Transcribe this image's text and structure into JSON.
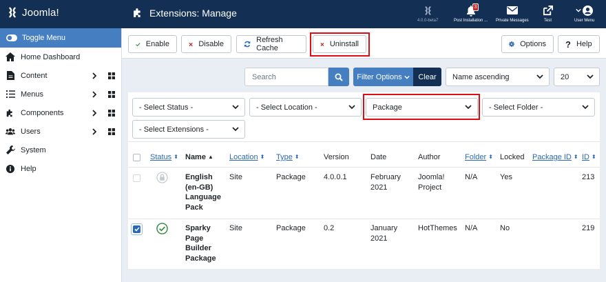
{
  "app": {
    "brand": "Joomla!",
    "page_title": "Extensions: Manage"
  },
  "header": {
    "version": "4.0.0-beta7",
    "post_install": {
      "label": "Post Installation ...",
      "count": "3"
    },
    "private_messages": "Private Messages",
    "site": "Test",
    "user_menu": "User Menu"
  },
  "sidebar": {
    "toggle": "Toggle Menu",
    "items": [
      {
        "label": "Home Dashboard"
      },
      {
        "label": "Content"
      },
      {
        "label": "Menus"
      },
      {
        "label": "Components"
      },
      {
        "label": "Users"
      },
      {
        "label": "System"
      },
      {
        "label": "Help"
      }
    ]
  },
  "toolbar": {
    "enable": "Enable",
    "disable": "Disable",
    "refresh": "Refresh Cache",
    "uninstall": "Uninstall",
    "options": "Options",
    "help": "Help"
  },
  "search": {
    "placeholder": "Search",
    "filter_options": "Filter Options",
    "clear": "Clear",
    "ordering": "Name ascending",
    "limit": "20"
  },
  "filters": {
    "status": "- Select Status -",
    "location": "- Select Location -",
    "type": "Package",
    "folder": "- Select Folder -",
    "extensions": "- Select Extensions -"
  },
  "table": {
    "headers": {
      "status": "Status",
      "name": "Name",
      "location": "Location",
      "type": "Type",
      "version": "Version",
      "date": "Date",
      "author": "Author",
      "folder": "Folder",
      "locked": "Locked",
      "package_id": "Package ID",
      "id": "ID"
    },
    "rows": [
      {
        "checked": false,
        "status": "locked",
        "name": [
          "English",
          "(en-GB)",
          "Language",
          "Pack"
        ],
        "location": "Site",
        "type": "Package",
        "version": "4.0.0.1",
        "date": [
          "February",
          "2021"
        ],
        "author": [
          "Joomla!",
          "Project"
        ],
        "folder": "N/A",
        "locked": "Yes",
        "package_id": "",
        "id": "213"
      },
      {
        "checked": true,
        "status": "enabled",
        "name": [
          "Sparky",
          "Page",
          "Builder",
          "Package"
        ],
        "location": "Site",
        "type": "Package",
        "version": "0.2",
        "date": [
          "January",
          "2021"
        ],
        "author": [
          "HotThemes"
        ],
        "folder": "N/A",
        "locked": "No",
        "package_id": "",
        "id": "219"
      }
    ]
  },
  "colors": {
    "header": "#132f53",
    "accent": "#457fc2",
    "highlight": "#e00c14",
    "success": "#2f8a3a"
  }
}
